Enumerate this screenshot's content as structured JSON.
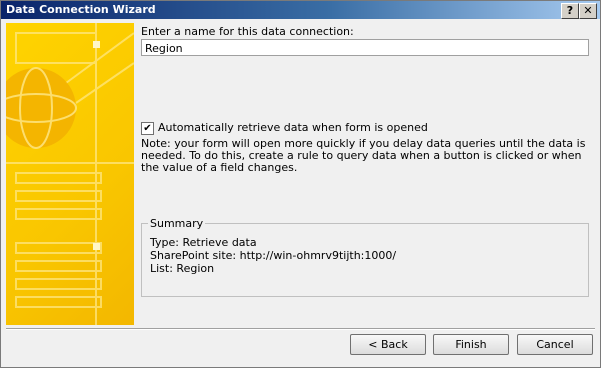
{
  "window": {
    "title": "Data Connection Wizard"
  },
  "titlebar": {
    "help_label": "?",
    "close_label": "✕"
  },
  "form": {
    "name_prompt": "Enter a name for this data connection:",
    "name_value": "Region",
    "auto_retrieve_label": "Automatically retrieve data when form is opened",
    "auto_retrieve_checked": true,
    "note_text": "Note: your form will open more quickly if you delay data queries until the data is needed. To do this, create a rule to query data when a button is clicked or when the value of a field changes."
  },
  "summary": {
    "title": "Summary",
    "type_line": "Type: Retrieve data",
    "site_line": "SharePoint site: http://win-ohmrv9tijth:1000/",
    "list_line": "List: Region"
  },
  "buttons": {
    "back": "< Back",
    "finish": "Finish",
    "cancel": "Cancel"
  },
  "colors": {
    "banner": "#ffd400",
    "titlebar": "#0a246a"
  },
  "icons": {
    "check": "✔"
  }
}
